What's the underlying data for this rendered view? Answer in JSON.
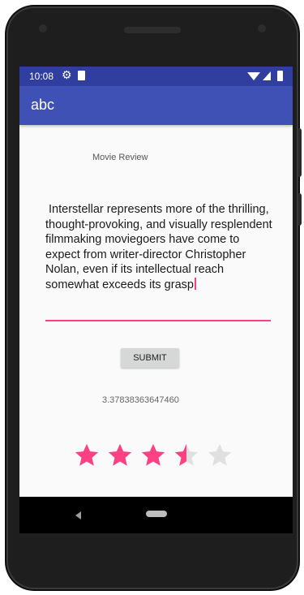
{
  "status_bar": {
    "time": "10:08",
    "icons": [
      "gear-icon",
      "sdcard-icon",
      "wifi-icon",
      "signal-icon",
      "battery-icon"
    ]
  },
  "app_bar": {
    "title": "abc"
  },
  "content": {
    "heading": "Movie Review",
    "review_text": " Interstellar represents more of the thrilling, thought-provoking, and visually resplendent filmmaking moviegoers have come to expect from writer-director Christopher Nolan, even if its intellectual reach somewhat exceeds its grasp",
    "submit_label": "SUBMIT",
    "result_value": "3.37838363647460"
  },
  "rating": {
    "value": 3.5,
    "max": 5
  },
  "colors": {
    "status_bar": "#303f9f",
    "app_bar": "#3f51b5",
    "accent": "#ff4081",
    "star_empty": "#e0e0e0"
  },
  "navigation_bar": {
    "icons": [
      "back-icon",
      "home-icon"
    ]
  }
}
